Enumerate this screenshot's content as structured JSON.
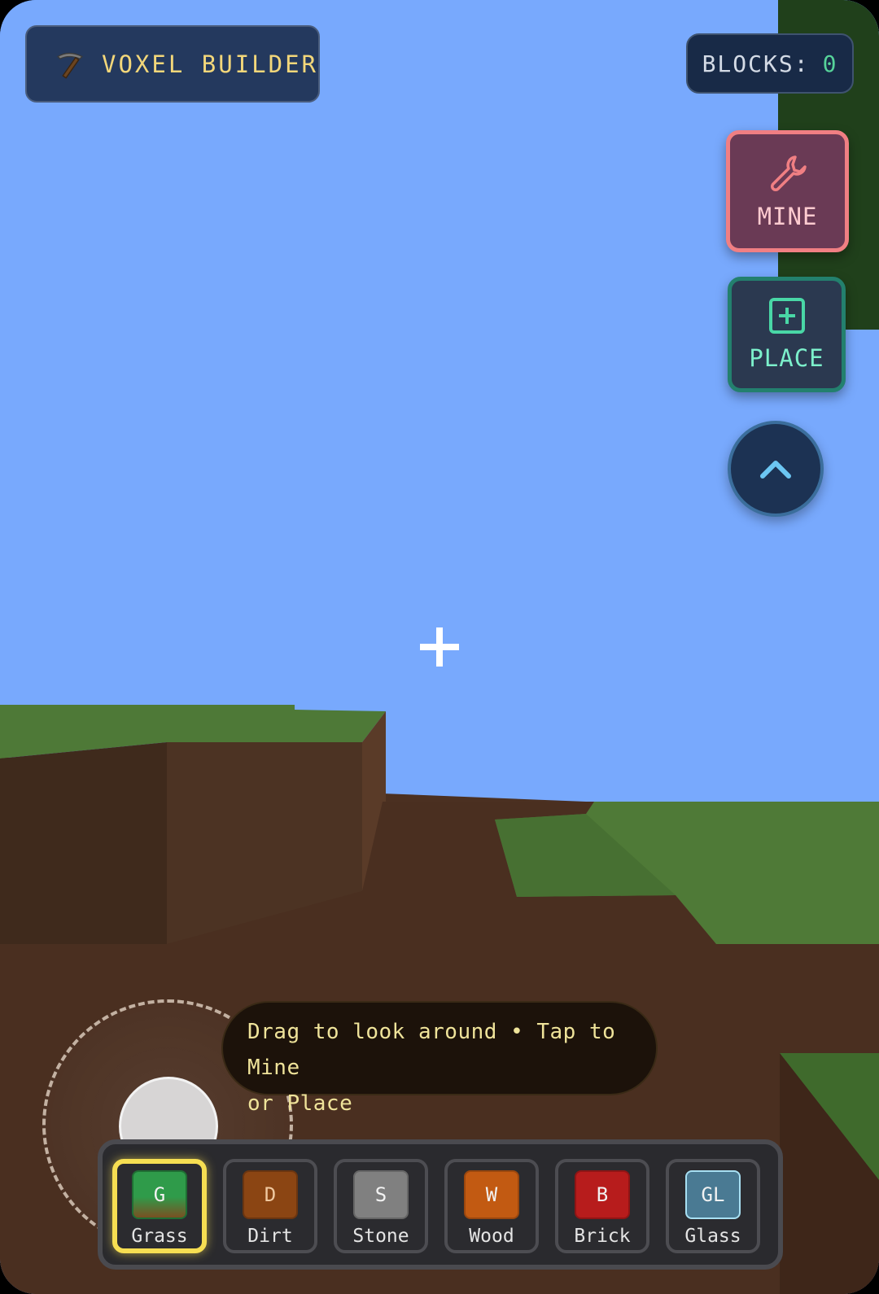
{
  "app": {
    "title": "VOXEL BUILDER",
    "logo_icon": "pickaxe-icon"
  },
  "stats": {
    "blocks_label": "BLOCKS:",
    "blocks_count": "0"
  },
  "actions": {
    "mine_label": "MINE",
    "mine_icon": "wrench-icon",
    "mine_color": "#f07f83",
    "place_label": "PLACE",
    "place_icon": "plus-square-icon",
    "place_color": "#7cf0cb",
    "jump_icon": "chevron-up-icon"
  },
  "hint": {
    "line1": "Drag to look around • Tap to Mine",
    "line2": "or Place"
  },
  "hotbar": {
    "selected_index": 0,
    "highlight_color": "#f6de52",
    "slots": [
      {
        "key": "G",
        "label": "Grass",
        "color": "#3d9a4b"
      },
      {
        "key": "D",
        "label": "Dirt",
        "color": "#8b4513"
      },
      {
        "key": "S",
        "label": "Stone",
        "color": "#808080"
      },
      {
        "key": "W",
        "label": "Wood",
        "color": "#c25a12"
      },
      {
        "key": "B",
        "label": "Brick",
        "color": "#b71c1c"
      },
      {
        "key": "GL",
        "label": "Glass",
        "color": "#4a7a93"
      }
    ]
  },
  "scene": {
    "sky_color": "#78a9fd",
    "grass_color": "#4f7a37",
    "dirt_color": "#4b3021"
  }
}
